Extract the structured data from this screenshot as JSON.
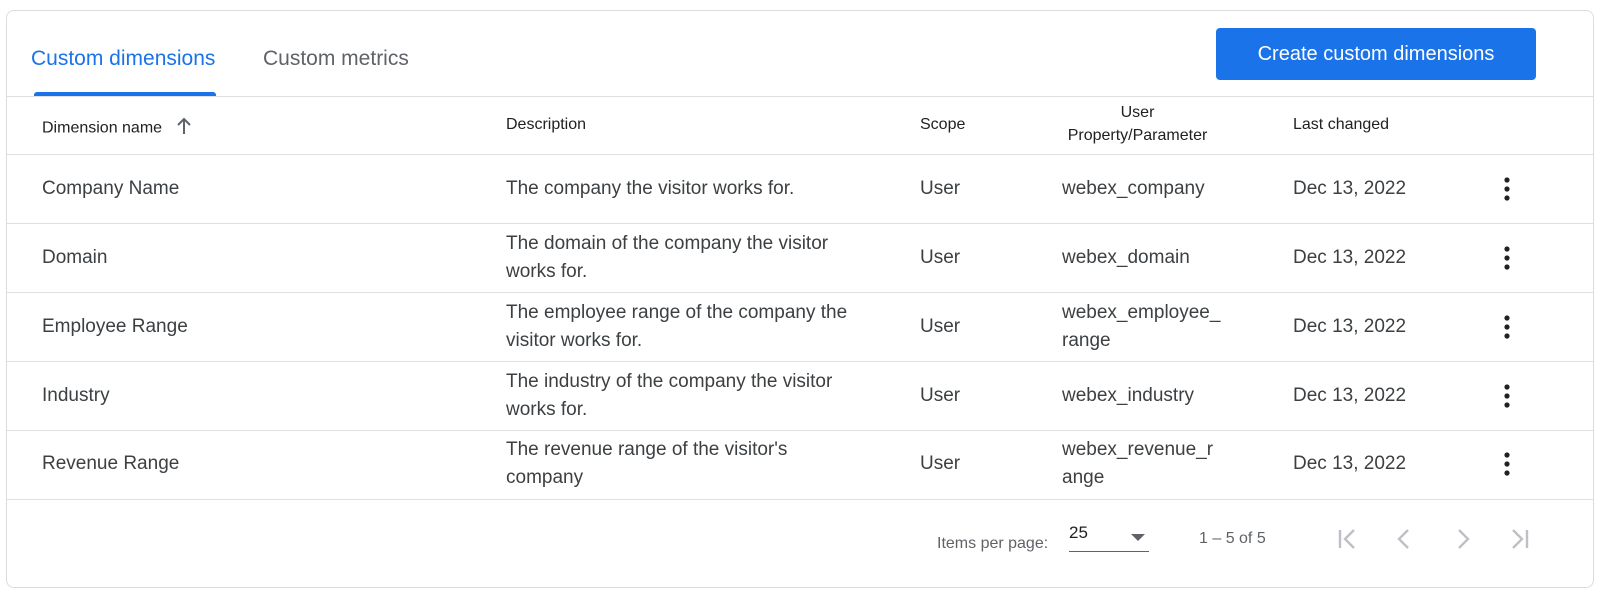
{
  "tabs": [
    {
      "label": "Custom dimensions",
      "active": true
    },
    {
      "label": "Custom metrics",
      "active": false
    }
  ],
  "actions": {
    "create_label": "Create custom dimensions"
  },
  "colors": {
    "accent": "#1a73e8",
    "border": "#dadce0",
    "text": "#3c4043"
  },
  "table": {
    "headers": {
      "name": "Dimension name",
      "description": "Description",
      "scope": "Scope",
      "param_line1": "User",
      "param_line2": "Property/Parameter",
      "last_changed": "Last changed"
    },
    "sort_icon": "arrow-up-icon",
    "rows": [
      {
        "name": "Company Name",
        "description": "The company the visitor works for.",
        "scope": "User",
        "param": "webex_company",
        "last_changed": "Dec 13, 2022"
      },
      {
        "name": "Domain",
        "description": "The domain of the company the visitor works for.",
        "scope": "User",
        "param": "webex_domain",
        "last_changed": "Dec 13, 2022"
      },
      {
        "name": "Employee Range",
        "description": "The employee range of the company the visitor works for.",
        "scope": "User",
        "param": "webex_employee_range",
        "last_changed": "Dec 13, 2022"
      },
      {
        "name": "Industry",
        "description": "The industry of the company the visitor works for.",
        "scope": "User",
        "param": "webex_industry",
        "last_changed": "Dec 13, 2022"
      },
      {
        "name": "Revenue Range",
        "description": "The revenue range of the visitor's company",
        "scope": "User",
        "param": "webex_revenue_range",
        "last_changed": "Dec 13, 2022"
      }
    ]
  },
  "pagination": {
    "items_per_page_label": "Items per page:",
    "items_per_page_value": "25",
    "range_text": "1 – 5 of 5",
    "icons": [
      "first-page-icon",
      "previous-page-icon",
      "next-page-icon",
      "last-page-icon"
    ]
  }
}
